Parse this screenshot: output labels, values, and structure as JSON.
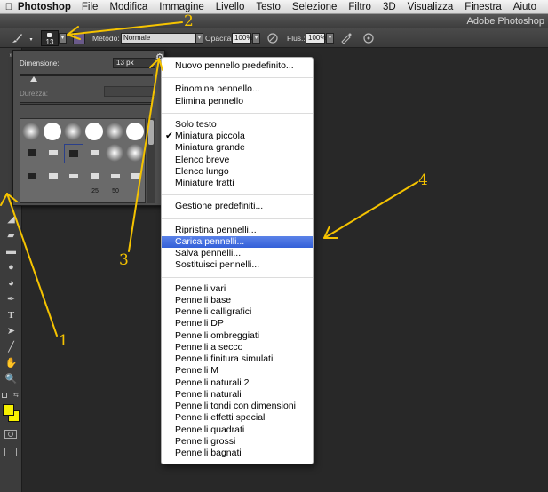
{
  "menubar": {
    "app": "Photoshop",
    "items": [
      "File",
      "Modifica",
      "Immagine",
      "Livello",
      "Testo",
      "Selezione",
      "Filtro",
      "3D",
      "Visualizza",
      "Finestra",
      "Aiuto"
    ]
  },
  "titlebar": {
    "title": "Adobe Photoshop"
  },
  "options": {
    "brush_size": "13",
    "mode_label": "Metodo:",
    "mode_value": "Normale",
    "opacity_label": "Opacità:",
    "opacity_value": "100%",
    "flow_label": "Flus.:",
    "flow_value": "100%"
  },
  "brush_panel": {
    "size_label": "Dimensione:",
    "size_value": "13 px",
    "hardness_label": "Durezza:",
    "brush_numbers": [
      "25",
      "50"
    ]
  },
  "menu": {
    "groups": [
      [
        "Nuovo pennello predefinito..."
      ],
      [
        "Rinomina pennello...",
        "Elimina pennello"
      ],
      [
        "Solo testo",
        "Miniatura piccola",
        "Miniatura grande",
        "Elenco breve",
        "Elenco lungo",
        "Miniature tratti"
      ],
      [
        "Gestione predefiniti..."
      ],
      [
        "Ripristina pennelli...",
        "Carica pennelli...",
        "Salva pennelli...",
        "Sostituisci pennelli..."
      ],
      [
        "Pennelli vari",
        "Pennelli base",
        "Pennelli calligrafici",
        "Pennelli DP",
        "Pennelli ombreggiati",
        "Pennelli a secco",
        "Pennelli finitura simulati",
        "Pennelli M",
        "Pennelli naturali 2",
        "Pennelli naturali",
        "Pennelli tondi con dimensioni",
        "Pennelli effetti speciali",
        "Pennelli quadrati",
        "Pennelli grossi",
        "Pennelli bagnati"
      ]
    ],
    "checked_item": "Miniatura piccola",
    "highlighted_item": "Carica pennelli..."
  },
  "annotations": [
    "1",
    "2",
    "3",
    "4"
  ],
  "colors": {
    "annotation": "#f5c300",
    "highlight": "#3a66dc",
    "foreground_swatch": "#f5f000"
  }
}
